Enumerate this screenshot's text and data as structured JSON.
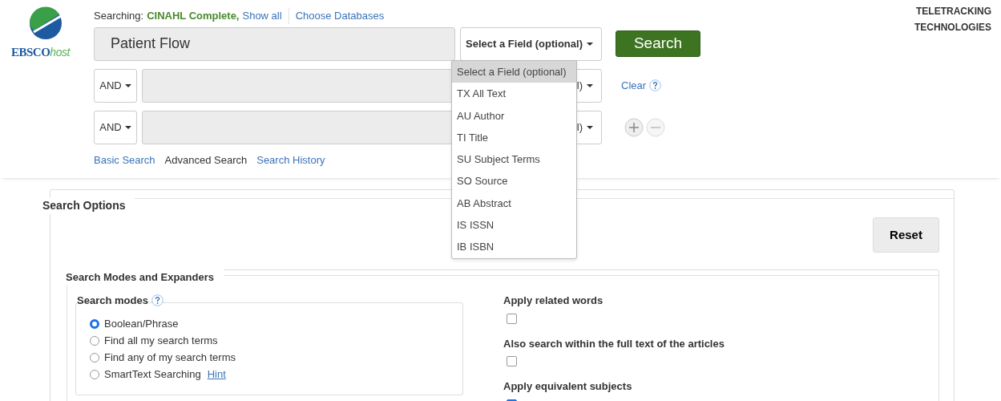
{
  "logo": {
    "name": "EBSCO",
    "suffix": "host"
  },
  "searching": {
    "label": "Searching:",
    "database": "CINAHL Complete,",
    "show_all": "Show all",
    "choose": "Choose Databases"
  },
  "search_rows": [
    {
      "query": "Patient Flow",
      "field": "Select a Field (optional)"
    },
    {
      "operator": "AND",
      "field": "l)"
    },
    {
      "operator": "AND",
      "field": "l)"
    }
  ],
  "search_button": "Search",
  "clear": "Clear",
  "nav_links": [
    {
      "label": "Basic Search",
      "selected": false
    },
    {
      "label": "Advanced Search",
      "selected": true
    },
    {
      "label": "Search History",
      "selected": false
    }
  ],
  "brand": [
    "TELETRACKING",
    "TECHNOLOGIES"
  ],
  "field_menu": [
    {
      "label": "Select a Field (optional)",
      "selected": true
    },
    {
      "label": "TX All Text",
      "selected": false
    },
    {
      "label": "AU Author",
      "selected": false
    },
    {
      "label": "TI Title",
      "selected": false
    },
    {
      "label": "SU Subject Terms",
      "selected": false
    },
    {
      "label": "SO Source",
      "selected": false
    },
    {
      "label": "AB Abstract",
      "selected": false
    },
    {
      "label": "IS ISSN",
      "selected": false
    },
    {
      "label": "IB ISBN",
      "selected": false
    }
  ],
  "search_options": {
    "title": "Search Options",
    "reset": "Reset",
    "modes_and_expanders": {
      "title": "Search Modes and Expanders",
      "search_modes": {
        "title": "Search modes",
        "options": [
          {
            "label": "Boolean/Phrase",
            "selected": true
          },
          {
            "label": "Find all my search terms",
            "selected": false
          },
          {
            "label": "Find any of my search terms",
            "selected": false
          },
          {
            "label": "SmartText Searching",
            "selected": false,
            "hint": "Hint"
          }
        ]
      },
      "expanders": [
        {
          "label": "Apply related words",
          "checked": false
        },
        {
          "label": "Also search within the full text of the articles",
          "checked": false
        },
        {
          "label": "Apply equivalent subjects",
          "checked": true
        }
      ]
    }
  }
}
